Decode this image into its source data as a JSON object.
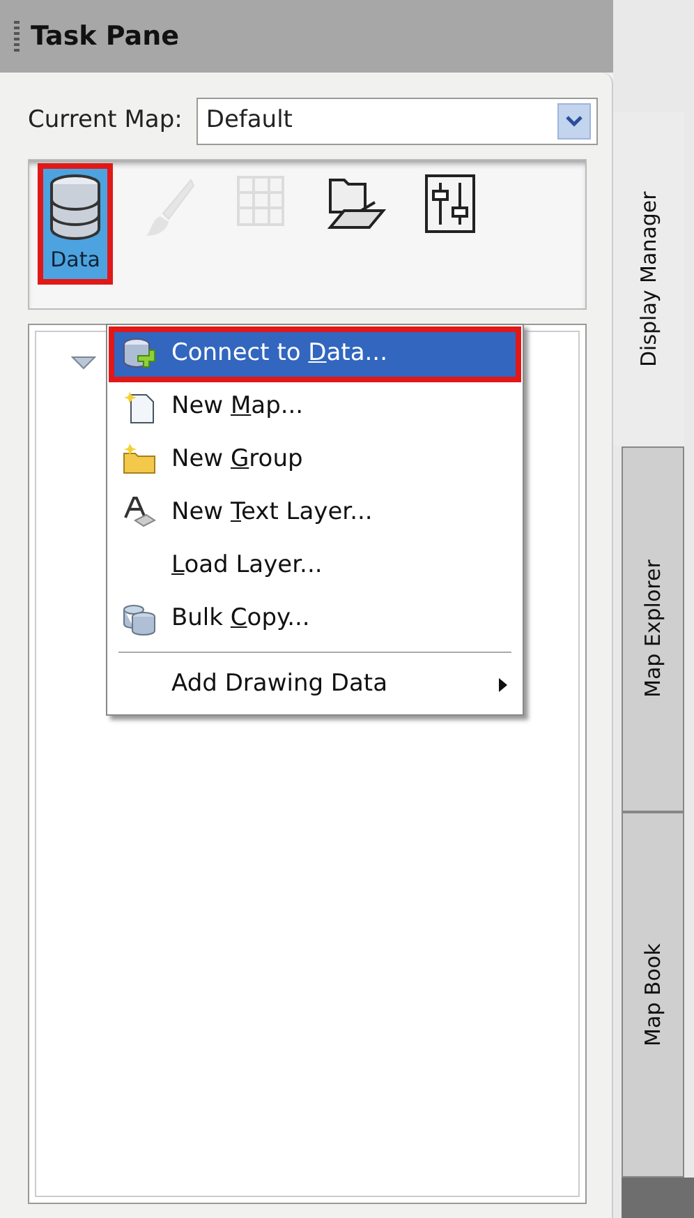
{
  "window": {
    "title": "Task Pane"
  },
  "current_map": {
    "label": "Current Map:",
    "value": "Default"
  },
  "toolbar": [
    {
      "kind": "data",
      "label": "Data",
      "selected": true,
      "highlighted": true,
      "disabled": false
    },
    {
      "kind": "style",
      "selected": false,
      "highlighted": false,
      "disabled": true
    },
    {
      "kind": "table",
      "selected": false,
      "highlighted": false,
      "disabled": true
    },
    {
      "kind": "layers",
      "selected": false,
      "highlighted": false,
      "disabled": false
    },
    {
      "kind": "tools",
      "selected": false,
      "highlighted": false,
      "disabled": false
    }
  ],
  "tree": {
    "expanded": true
  },
  "menu": [
    {
      "kind": "connect",
      "text_before": "Connect to ",
      "access_key": "D",
      "text_after": "ata...",
      "selected": true,
      "highlighted": true
    },
    {
      "kind": "map",
      "text_before": "New ",
      "access_key": "M",
      "text_after": "ap...",
      "selected": false,
      "highlighted": false
    },
    {
      "kind": "group",
      "text_before": "New ",
      "access_key": "G",
      "text_after": "roup",
      "selected": false,
      "highlighted": false
    },
    {
      "kind": "text",
      "text_before": "New ",
      "access_key": "T",
      "text_after": "ext Layer...",
      "selected": false,
      "highlighted": false
    },
    {
      "kind": "none",
      "access_key": "L",
      "text_after": "oad Layer...",
      "selected": false,
      "highlighted": false
    },
    {
      "kind": "bulk",
      "text_before": "Bulk ",
      "access_key": "C",
      "text_after": "opy...",
      "selected": false,
      "highlighted": false
    },
    {
      "kind": "separator"
    },
    {
      "kind": "submenu",
      "text_before": "Add Drawing Data",
      "selected": false,
      "highlighted": false
    }
  ],
  "side_tabs": [
    {
      "label": "Display Manager",
      "selected": true
    },
    {
      "label": "Map Explorer",
      "selected": false
    },
    {
      "label": "Map Book",
      "selected": false
    }
  ]
}
